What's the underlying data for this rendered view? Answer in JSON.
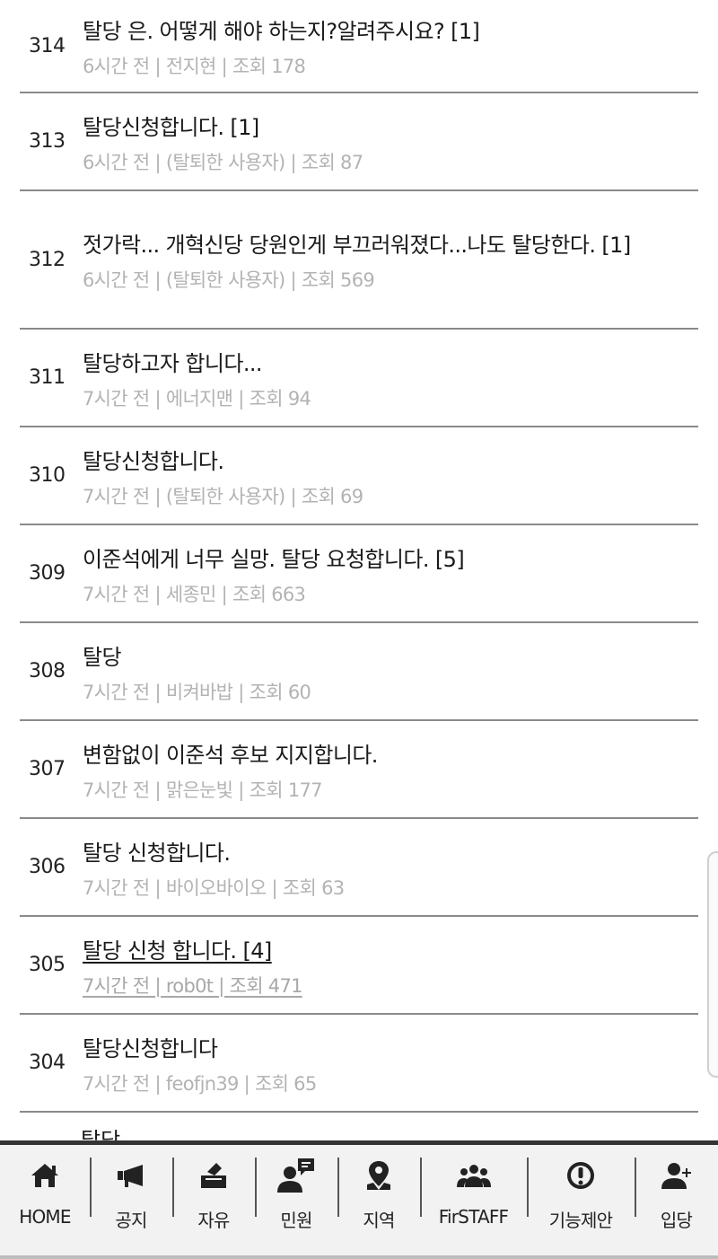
{
  "posts": [
    {
      "num": "314",
      "title": "탈당 은. 어떻게 해야 하는지?알려주시요? [1]",
      "meta": "6시간 전 | 전지현 | 조회 178"
    },
    {
      "num": "313",
      "title": "탈당신청합니다. [1]",
      "meta": "6시간 전 | (탈퇴한 사용자) | 조회 87"
    },
    {
      "num": "312",
      "title": "젓가락... 개혁신당 당원인게 부끄러워졌다...나도 탈당한다. [1]",
      "meta": "6시간 전 | (탈퇴한 사용자) | 조회 569"
    },
    {
      "num": "311",
      "title": "탈당하고자 합니다...",
      "meta": "7시간 전 | 에너지맨 | 조회 94"
    },
    {
      "num": "310",
      "title": "탈당신청합니다.",
      "meta": "7시간 전 | (탈퇴한 사용자) | 조회 69"
    },
    {
      "num": "309",
      "title": "이준석에게 너무 실망. 탈당 요청합니다. [5]",
      "meta": "7시간 전 | 세종민 | 조회 663"
    },
    {
      "num": "308",
      "title": "탈당",
      "meta": "7시간 전 | 비켜바밥 | 조회 60"
    },
    {
      "num": "307",
      "title": "변함없이 이준석 후보 지지합니다.",
      "meta": "7시간 전 | 맑은눈빛 | 조회 177"
    },
    {
      "num": "306",
      "title": "탈당 신청합니다.",
      "meta": "7시간 전 | 바이오바이오 | 조회 63"
    },
    {
      "num": "305",
      "title": "탈당 신청 합니다. [4]",
      "meta": "7시간 전 | rob0t | 조회 471"
    },
    {
      "num": "304",
      "title": "탈당신청합니다",
      "meta": "7시간 전 | feofjn39 | 조회 65"
    }
  ],
  "partial_next_title": "탈당",
  "nav": [
    {
      "label": "HOME",
      "icon": "home-icon"
    },
    {
      "label": "공지",
      "icon": "megaphone-icon"
    },
    {
      "label": "자유",
      "icon": "ballot-box-icon"
    },
    {
      "label": "민원",
      "icon": "user-message-icon"
    },
    {
      "label": "지역",
      "icon": "map-pin-icon"
    },
    {
      "label": "FirSTAFF",
      "icon": "group-icon"
    },
    {
      "label": "기능제안",
      "icon": "alert-circle-icon"
    },
    {
      "label": "입당",
      "icon": "add-user-icon"
    }
  ]
}
